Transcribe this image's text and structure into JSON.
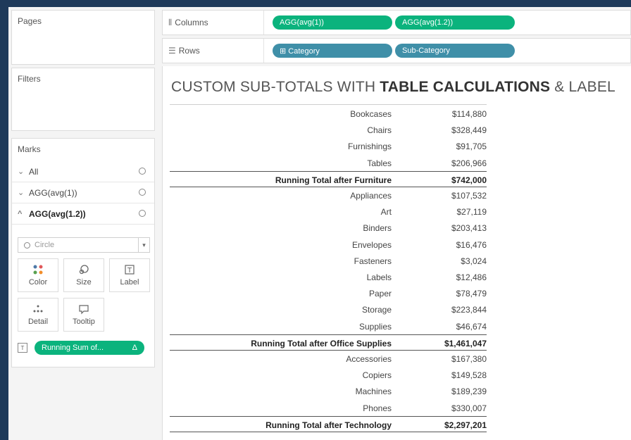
{
  "left_panel": {
    "pages_title": "Pages",
    "filters_title": "Filters",
    "marks_title": "Marks",
    "marks_rows": [
      {
        "label": "All",
        "chevron": "⌄",
        "active": false
      },
      {
        "label": "AGG(avg(1))",
        "chevron": "⌄",
        "active": false
      },
      {
        "label": "AGG(avg(1.2))",
        "chevron": "^",
        "active": true
      }
    ],
    "mark_type": "Circle",
    "buttons": {
      "color": "Color",
      "size": "Size",
      "label": "Label",
      "detail": "Detail",
      "tooltip": "Tooltip"
    },
    "label_pill": "Running Sum of...",
    "label_pill_icon": "Δ",
    "label_pill_color": "#0bb37d"
  },
  "shelves": {
    "columns_label": "Columns",
    "rows_label": "Rows",
    "columns_pills": [
      "AGG(avg(1))",
      "AGG(avg(1.2))"
    ],
    "rows_pills": [
      "⊞ Category",
      "Sub-Category"
    ],
    "measure_color": "#0bb37d",
    "dimension_color": "#3f8fa8"
  },
  "viz": {
    "title_light": "CUSTOM SUB-TOTALS WITH ",
    "title_bold": "TABLE CALCULATIONS",
    "title_tail": " & LABEL",
    "rows": [
      {
        "cat": "Bookcases",
        "val": "$114,880",
        "total": false
      },
      {
        "cat": "Chairs",
        "val": "$328,449",
        "total": false
      },
      {
        "cat": "Furnishings",
        "val": "$91,705",
        "total": false
      },
      {
        "cat": "Tables",
        "val": "$206,966",
        "total": false
      },
      {
        "cat": "Running Total after Furniture",
        "val": "$742,000",
        "total": true
      },
      {
        "cat": "Appliances",
        "val": "$107,532",
        "total": false
      },
      {
        "cat": "Art",
        "val": "$27,119",
        "total": false
      },
      {
        "cat": "Binders",
        "val": "$203,413",
        "total": false
      },
      {
        "cat": "Envelopes",
        "val": "$16,476",
        "total": false
      },
      {
        "cat": "Fasteners",
        "val": "$3,024",
        "total": false
      },
      {
        "cat": "Labels",
        "val": "$12,486",
        "total": false
      },
      {
        "cat": "Paper",
        "val": "$78,479",
        "total": false
      },
      {
        "cat": "Storage",
        "val": "$223,844",
        "total": false
      },
      {
        "cat": "Supplies",
        "val": "$46,674",
        "total": false
      },
      {
        "cat": "Running Total after Office Supplies",
        "val": "$1,461,047",
        "total": true
      },
      {
        "cat": "Accessories",
        "val": "$167,380",
        "total": false
      },
      {
        "cat": "Copiers",
        "val": "$149,528",
        "total": false
      },
      {
        "cat": "Machines",
        "val": "$189,239",
        "total": false
      },
      {
        "cat": "Phones",
        "val": "$330,007",
        "total": false
      },
      {
        "cat": "Running Total after Technology",
        "val": "$2,297,201",
        "total": true
      }
    ]
  }
}
